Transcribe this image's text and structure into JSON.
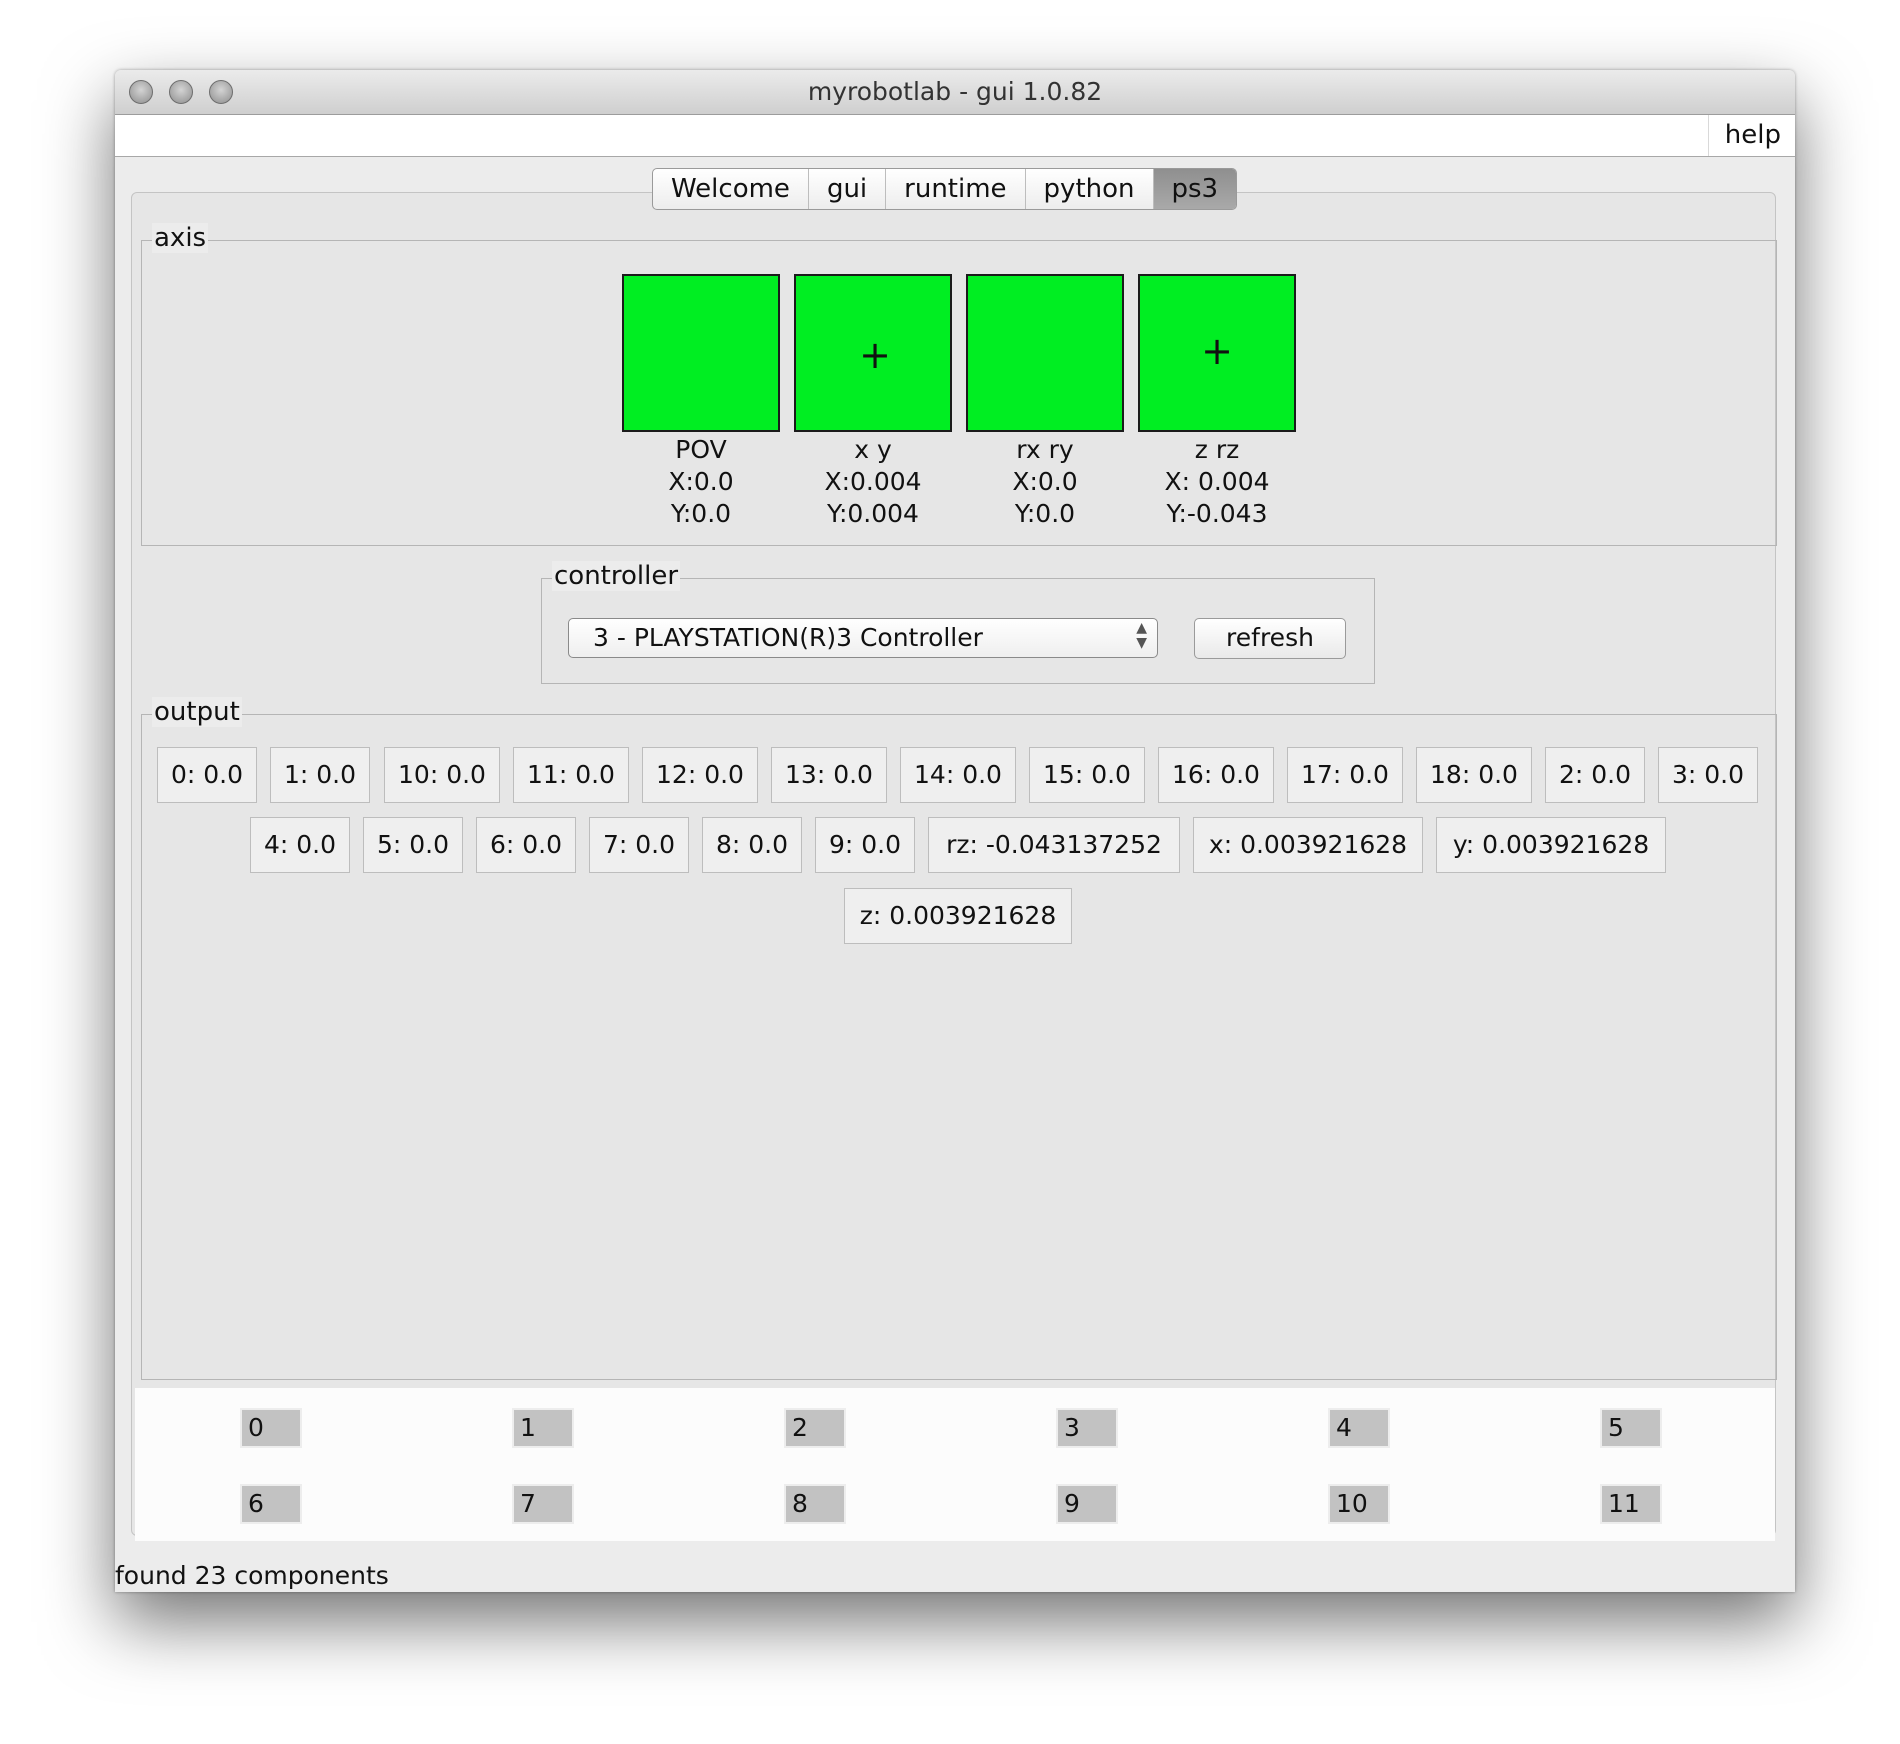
{
  "window": {
    "title": "myrobotlab - gui 1.0.82"
  },
  "menu": {
    "help": "help"
  },
  "tabs": [
    "Welcome",
    "gui",
    "runtime",
    "python",
    "ps3"
  ],
  "active_tab": "ps3",
  "axis": {
    "legend": "axis",
    "box_color": "#00ee22",
    "boxes": [
      {
        "name": "POV",
        "x": "X:0.0",
        "y": "Y:0.0",
        "crosshair": false
      },
      {
        "name": "x y",
        "x": "X:0.004",
        "y": "Y:0.004",
        "crosshair": true
      },
      {
        "name": "rx ry",
        "x": "X:0.0",
        "y": "Y:0.0",
        "crosshair": false
      },
      {
        "name": "z rz",
        "x": "X: 0.004",
        "y": "Y:-0.043",
        "crosshair": true
      }
    ]
  },
  "controller": {
    "legend": "controller",
    "selected": "3 - PLAYSTATION(R)3 Controller",
    "refresh_label": "refresh"
  },
  "output": {
    "legend": "output",
    "row1": [
      "0: 0.0",
      "1: 0.0",
      "10: 0.0",
      "11: 0.0",
      "12: 0.0",
      "13: 0.0",
      "14: 0.0",
      "15: 0.0",
      "16: 0.0",
      "17: 0.0",
      "18: 0.0",
      "2: 0.0",
      "3: 0.0"
    ],
    "row2": [
      "4: 0.0",
      "5: 0.0",
      "6: 0.0",
      "7: 0.0",
      "8: 0.0",
      "9: 0.0",
      "rz: -0.043137252",
      "x: 0.003921628",
      "y: 0.003921628"
    ],
    "row3": [
      "z: 0.003921628"
    ]
  },
  "buttons": {
    "row1": [
      "0",
      "1",
      "2",
      "3",
      "4",
      "5"
    ],
    "row2": [
      "6",
      "7",
      "8",
      "9",
      "10",
      "11"
    ]
  },
  "status": "found 23 components"
}
